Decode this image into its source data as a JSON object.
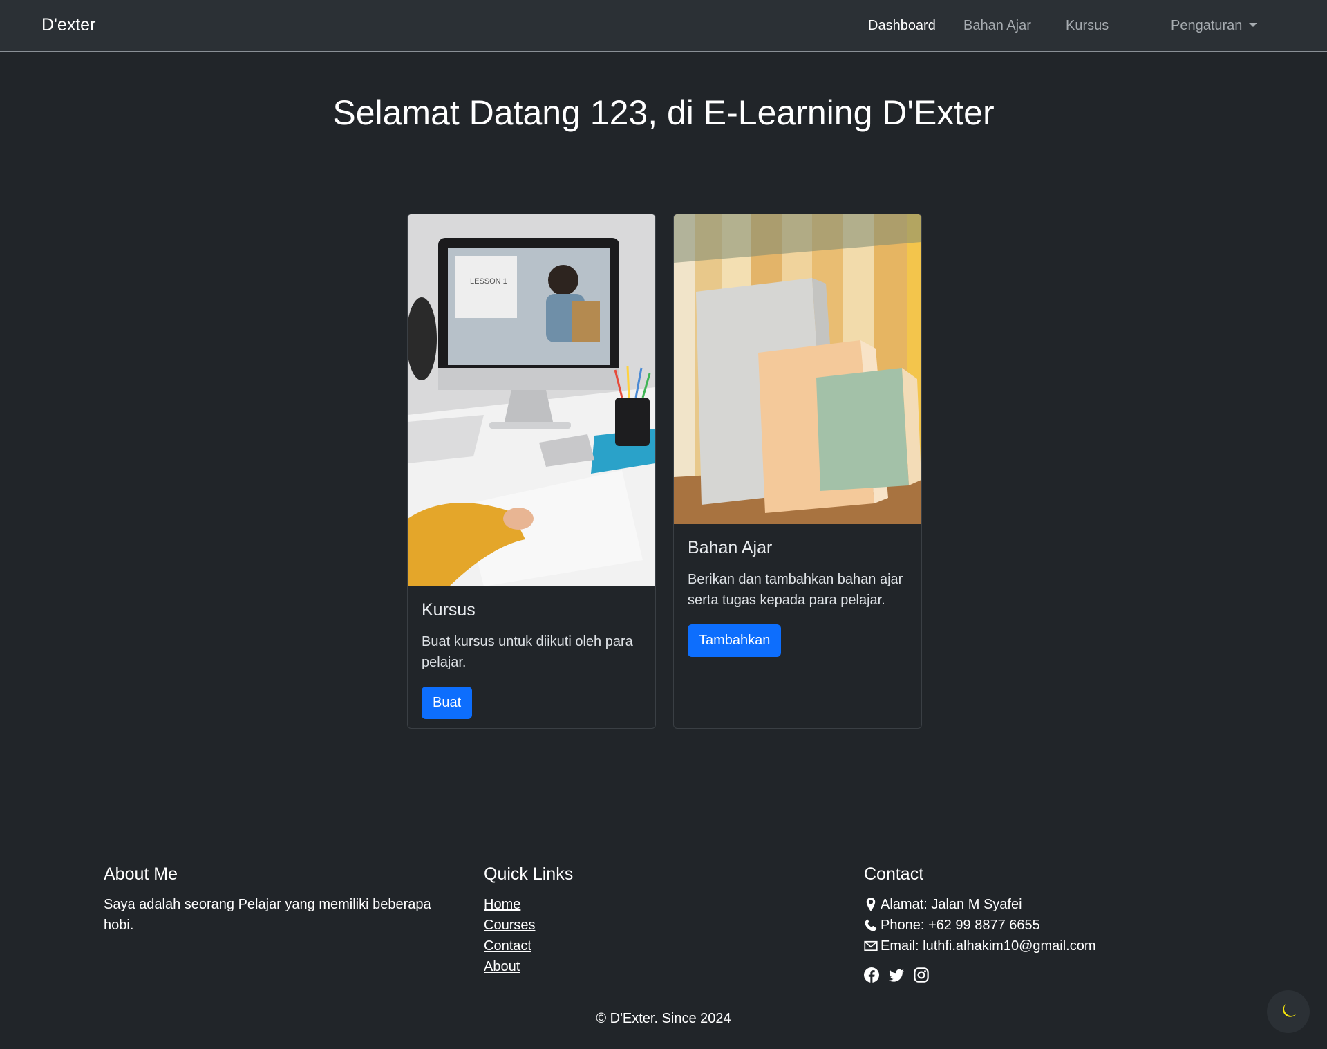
{
  "navbar": {
    "brand": "D'exter",
    "links": [
      {
        "label": "Dashboard",
        "active": true
      },
      {
        "label": "Bahan Ajar",
        "active": false
      },
      {
        "label": "Kursus",
        "active": false
      }
    ],
    "settings_label": "Pengaturan"
  },
  "main": {
    "title": "Selamat Datang 123, di E-Learning D'Exter"
  },
  "cards": [
    {
      "title": "Kursus",
      "text": "Buat kursus untuk diikuti oleh para pelajar.",
      "button": "Buat",
      "image_icon": "online-lesson-photo"
    },
    {
      "title": "Bahan Ajar",
      "text": "Berikan dan tambahkan bahan ajar serta tugas kepada para pelajar.",
      "button": "Tambahkan",
      "image_icon": "books-photo"
    }
  ],
  "footer": {
    "about": {
      "heading": "About Me",
      "text": "Saya adalah seorang Pelajar yang memiliki beberapa hobi."
    },
    "quick_links": {
      "heading": "Quick Links",
      "links": [
        "Home",
        "Courses",
        "Contact",
        "About"
      ]
    },
    "contact": {
      "heading": "Contact",
      "address": "Alamat: Jalan M Syafei",
      "phone": "Phone: +62 99 8877 6655",
      "email": "Email: luthfi.alhakim10@gmail.com",
      "socials": [
        "facebook-icon",
        "twitter-icon",
        "instagram-icon"
      ]
    },
    "copyright": "© D'Exter. Since 2024"
  },
  "theme_toggle_icon": "moon-icon",
  "colors": {
    "background": "#212529",
    "navbar": "#2b3035",
    "primary_button": "#0d6efd",
    "moon": "#f5e50a"
  }
}
